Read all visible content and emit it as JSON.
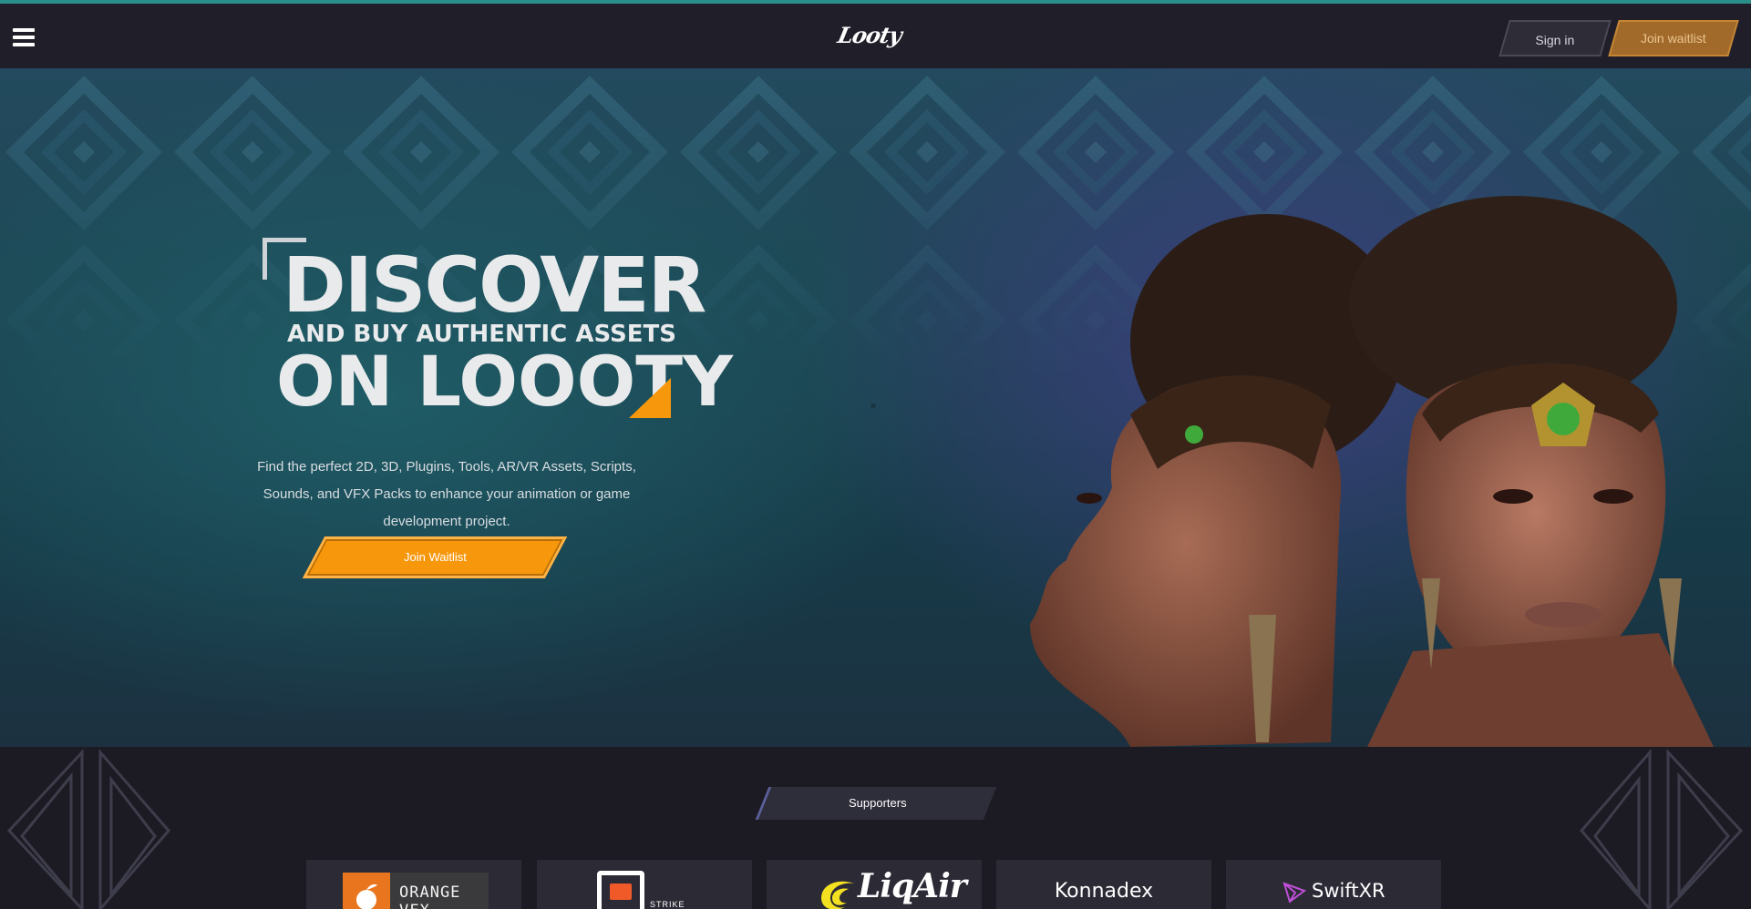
{
  "header": {
    "logo_text": "Looty",
    "signin_label": "Sign in",
    "join_label": "Join waitlist"
  },
  "hero": {
    "headline_1": "DISCOVER",
    "headline_2": "AND BUY AUTHENTIC ASSETS",
    "headline_3": "ON LOOOTY",
    "description": "Find the perfect 2D, 3D, Plugins, Tools, AR/VR Assets, Scripts, Sounds, and VFX Packs to enhance your animation or game development project.",
    "cta_label": "Join Waitlist",
    "stray_mark": "="
  },
  "supporters": {
    "tag_label": "Supporters",
    "logos": [
      {
        "name": "ORANGE VFX"
      },
      {
        "name": "STRIKE"
      },
      {
        "name": "LiqAir"
      },
      {
        "name": "Konnadex"
      },
      {
        "name": "SwiftXR"
      }
    ]
  },
  "colors": {
    "accent_orange": "#f7970c",
    "header_bg": "#201f29",
    "page_bg": "#1c1b24",
    "teal_line": "#2a8f8a"
  }
}
